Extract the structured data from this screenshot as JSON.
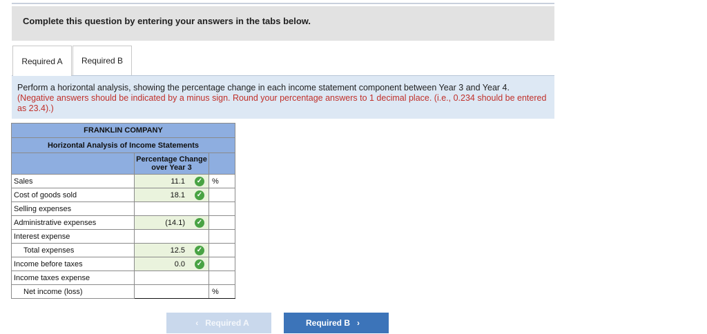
{
  "banner": {
    "text": "Complete this question by entering your answers in the tabs below."
  },
  "tabs": [
    {
      "label": "Required A"
    },
    {
      "label": "Required B"
    }
  ],
  "instructions": {
    "main": "Perform a horizontal analysis, showing the percentage change in each income statement component between Year 3 and Year 4.",
    "note": "(Negative answers should be indicated by a minus sign. Round your percentage answers to 1 decimal place. (i.e., 0.234 should be entered as 23.4).)"
  },
  "table": {
    "company": "FRANKLIN COMPANY",
    "subtitle": "Horizontal Analysis of Income Statements",
    "col_header": "Percentage Change over Year 3",
    "rows": [
      {
        "label": "Sales",
        "value": "11.1",
        "pct": "%"
      },
      {
        "label": "Cost of goods sold",
        "value": "18.1",
        "pct": ""
      },
      {
        "label": "Selling expenses",
        "value": "",
        "pct": ""
      },
      {
        "label": "Administrative expenses",
        "value": "(14.1)",
        "pct": ""
      },
      {
        "label": "Interest expense",
        "value": "",
        "pct": ""
      },
      {
        "label": "Total expenses",
        "value": "12.5",
        "pct": ""
      },
      {
        "label": "Income before taxes",
        "value": "0.0",
        "pct": ""
      },
      {
        "label": "Income taxes expense",
        "value": "",
        "pct": ""
      },
      {
        "label": "Net income (loss)",
        "value": "",
        "pct": "%"
      }
    ],
    "check_mark": "✓"
  },
  "nav": {
    "prev_label": "Required A",
    "next_label": "Required B",
    "prev_arrow": "‹",
    "next_arrow": "›"
  },
  "colors": {
    "header_bg": "#8eaee0",
    "answer_bg": "#eaf3dd",
    "check_green": "#49a344",
    "next_btn": "#3c74b9",
    "prev_btn_disabled": "#c9d8ec",
    "note_red": "#c0302a"
  }
}
